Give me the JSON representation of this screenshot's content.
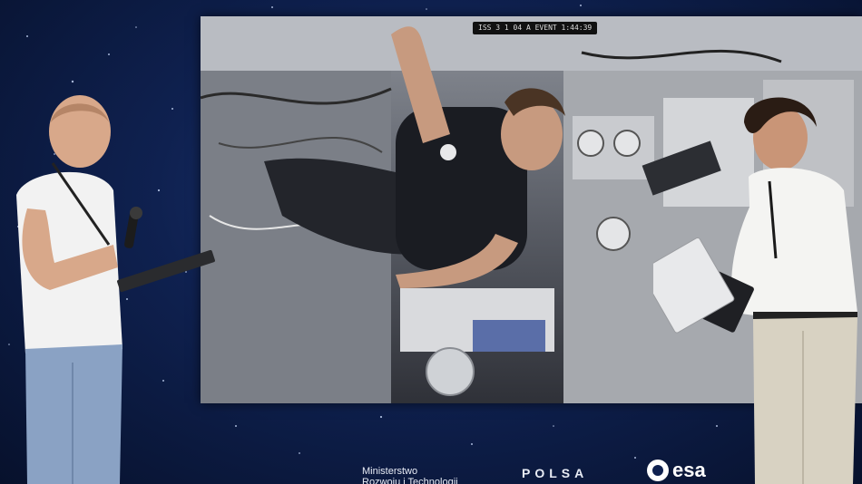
{
  "screen": {
    "osd_text": "ISS 3 1 04 A EVENT   1:44:39"
  },
  "footer": {
    "ministry_line1": "Ministerstwo",
    "ministry_line2": "Rozwoju i Technologii",
    "polsa_logo": "POLSA",
    "esa_logo": "esa"
  },
  "colors": {
    "background": "#0f2150",
    "shirt_white": "#f2f2f2",
    "jeans": "#8aa2c4",
    "trousers": "#d8d2c2",
    "astronaut_shirt": "#1a1c22"
  }
}
